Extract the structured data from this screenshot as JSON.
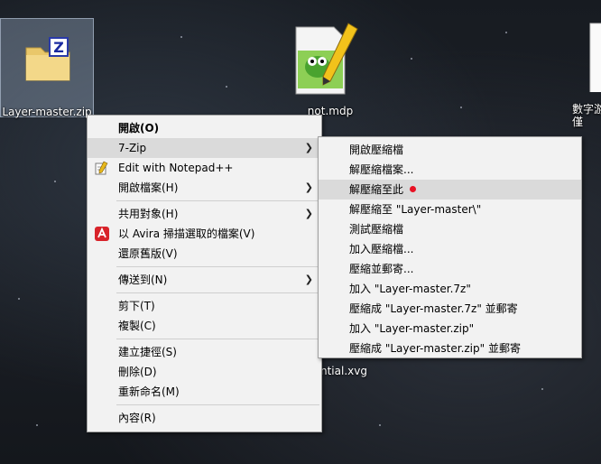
{
  "desktop": {
    "icons": [
      {
        "label": "Layer-master.zip"
      },
      {
        "label": "not.mdp"
      },
      {
        "label": "數字游\n僅"
      }
    ],
    "partial_text": "ntial.xvg"
  },
  "context_menu": {
    "items": [
      {
        "label": "開啟(O)"
      },
      {
        "label": "7-Zip"
      },
      {
        "label": "Edit with Notepad++"
      },
      {
        "label": "開啟檔案(H)"
      },
      {
        "label": "共用對象(H)"
      },
      {
        "label": "以 Avira 掃描選取的檔案(V)"
      },
      {
        "label": "還原舊版(V)"
      },
      {
        "label": "傳送到(N)"
      },
      {
        "label": "剪下(T)"
      },
      {
        "label": "複製(C)"
      },
      {
        "label": "建立捷徑(S)"
      },
      {
        "label": "刪除(D)"
      },
      {
        "label": "重新命名(M)"
      },
      {
        "label": "內容(R)"
      }
    ]
  },
  "zip_submenu": {
    "items": [
      {
        "label": "開啟壓縮檔"
      },
      {
        "label": "解壓縮檔案..."
      },
      {
        "label": "解壓縮至此"
      },
      {
        "label": "解壓縮至 \"Layer-master\\\""
      },
      {
        "label": "測試壓縮檔"
      },
      {
        "label": "加入壓縮檔..."
      },
      {
        "label": "壓縮並郵寄..."
      },
      {
        "label": "加入 \"Layer-master.7z\""
      },
      {
        "label": "壓縮成 \"Layer-master.7z\" 並郵寄"
      },
      {
        "label": "加入 \"Layer-master.zip\""
      },
      {
        "label": "壓縮成 \"Layer-master.zip\" 並郵寄"
      }
    ]
  },
  "colors": {
    "accent_dot": "#e81123",
    "menu_bg": "#f2f2f2",
    "hover_bg": "#dadada"
  }
}
